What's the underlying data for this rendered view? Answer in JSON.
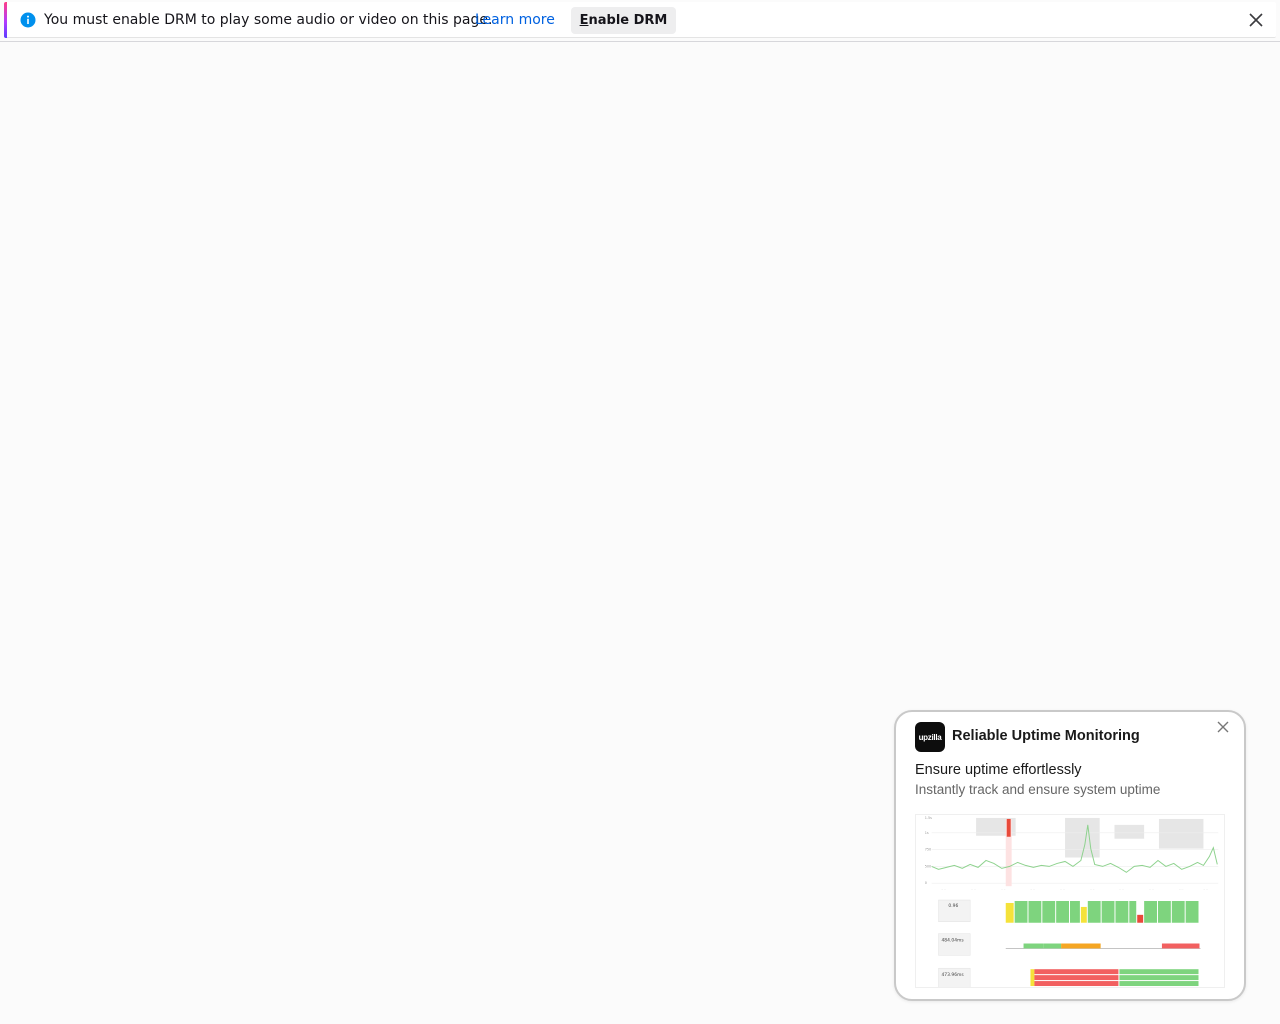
{
  "drm_bar": {
    "message": "You must enable DRM to play some audio or video on this page.",
    "learn_more": "Learn more",
    "button_prefix": "E",
    "button_rest": "nable DRM",
    "close_icon": "close-icon",
    "info_icon": "info-icon"
  },
  "ad": {
    "brand_logo_text": "upzilla",
    "brand": "Reliable Uptime Monitoring",
    "headline": "Ensure uptime effortlessly",
    "subtext": "Instantly track and ensure system uptime",
    "close_icon": "close-icon",
    "preview_metrics": [
      "0.96",
      "484.04ms",
      "473.96ms"
    ]
  },
  "colors": {
    "link": "#0061e0",
    "accent_top": "#ff3c85",
    "accent_bottom": "#5b3cff",
    "green": "#7ed47e",
    "yellow": "#f5e23a",
    "orange": "#f5a623",
    "red": "#f26060"
  }
}
